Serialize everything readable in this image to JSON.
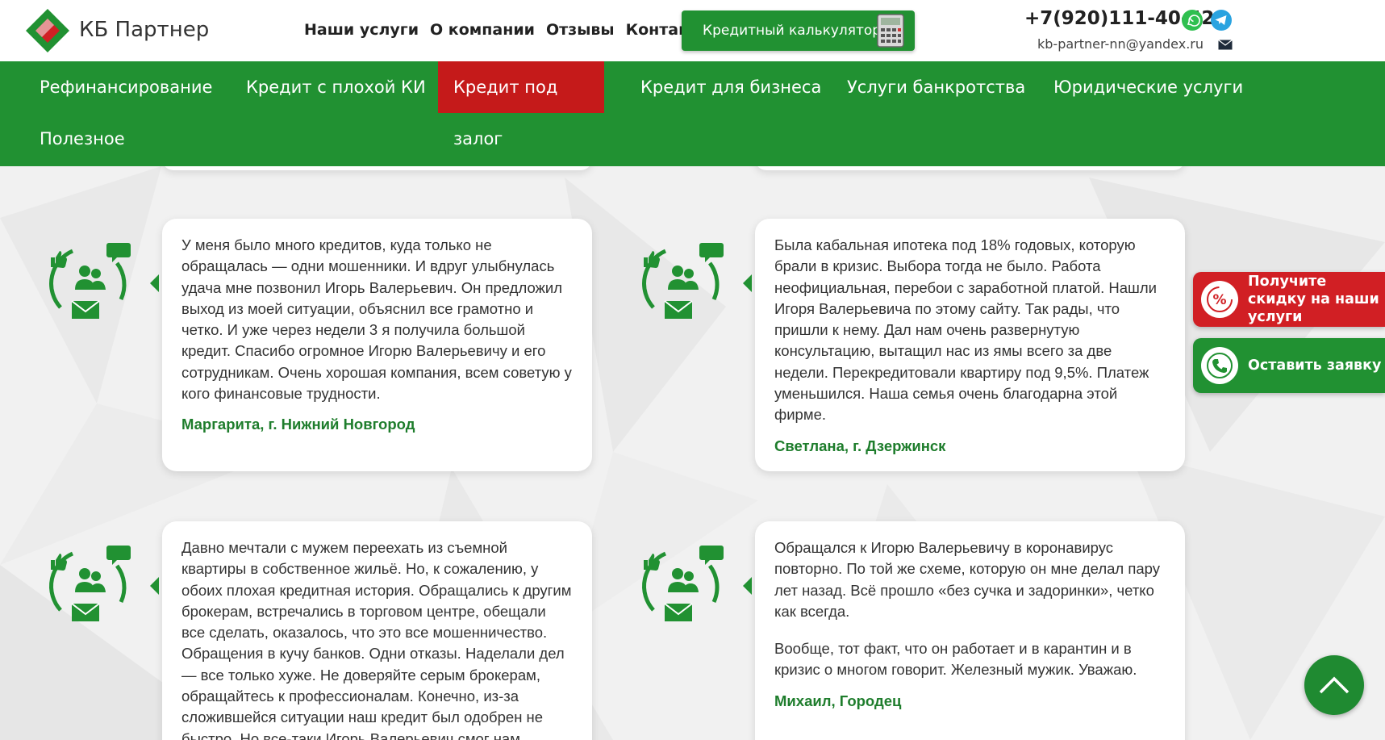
{
  "header": {
    "brand": "КБ Партнер",
    "nav": [
      "Наши услуги",
      "О компании",
      "Отзывы",
      "Контакты"
    ],
    "calc_button": "Кредитный калькулятор",
    "phone": "+7(920)111-40-42",
    "email": "kb-partner-nn@yandex.ru"
  },
  "menu": {
    "items": [
      "Рефинансирование",
      "Кредит с плохой КИ",
      "Кредит под залог",
      "Кредит для бизнеса",
      "Услуги банкротства",
      "Юридические услуги",
      "Полезное"
    ],
    "active": "Кредит под залог"
  },
  "reviews": [
    {
      "paragraphs": [
        "У меня было много кредитов, куда только не обращалась — одни мошенники. И вдруг улыбнулась удача мне позвонил Игорь Валерьевич. Он предложил выход из моей ситуации, объяснил все грамотно и четко. И уже через недели 3 я получила большой кредит. Спасибо огромное Игорю Валерьевичу и его сотрудникам. Очень хорошая компания, всем советую у кого финансовые трудности."
      ],
      "author": "Маргарита, г. Нижний Новгород"
    },
    {
      "paragraphs": [
        "Была кабальная ипотека под 18% годовых, которую брали в кризис. Выбора тогда не было. Работа неофициальная, перебои с заработной платой. Нашли Игоря Валерьевича по этому сайту. Так рады, что пришли к нему. Дал нам очень развернутую консультацию, вытащил нас из ямы всего за две недели. Перекредитовали квартиру под 9,5%. Платеж уменьшился. Наша семья очень благодарна этой фирме."
      ],
      "author": "Светлана, г. Дзержинск"
    },
    {
      "paragraphs": [
        "Давно мечтали с мужем переехать из съемной квартиры в собственное жильё. Но, к сожалению, у обоих плохая кредитная история. Обращались к другим брокерам, встречались в торговом центре, обещали все сделать, оказалось, что это все мошенничество. Обращения в кучу банков. Одни отказы. Наделали дел — все только хуже. Не доверяйте серым брокерам, обращайтесь к профессионалам. Конечно, из-за сложившейся ситуации наш кредит был одобрен не быстро. Но все-таки Игорь Валерьевич смог нам"
      ],
      "author": ""
    },
    {
      "paragraphs": [
        "Обращался к Игорю Валерьевичу в коронавирус повторно. По той же схеме, которую он мне делал пару лет назад. Всё прошло «без сучка и задоринки», четко как всегда.",
        "Вообще, тот факт, что он работает и в карантин и в кризис о многом говорит. Железный мужик. Уважаю."
      ],
      "author": "Михаил, Городец"
    }
  ],
  "side": {
    "discount": "Получите скидку на наши услуги",
    "request": "Оставить заявку"
  },
  "icons": [
    "logo-diamond-icon",
    "calculator-icon",
    "whatsapp-icon",
    "telegram-icon",
    "mail-icon",
    "review-icon",
    "discount-icon",
    "phone-icon",
    "arrow-up-icon"
  ],
  "colors": {
    "green": "#219132",
    "red": "#c51a1a",
    "author_green": "#1e7d2c"
  }
}
